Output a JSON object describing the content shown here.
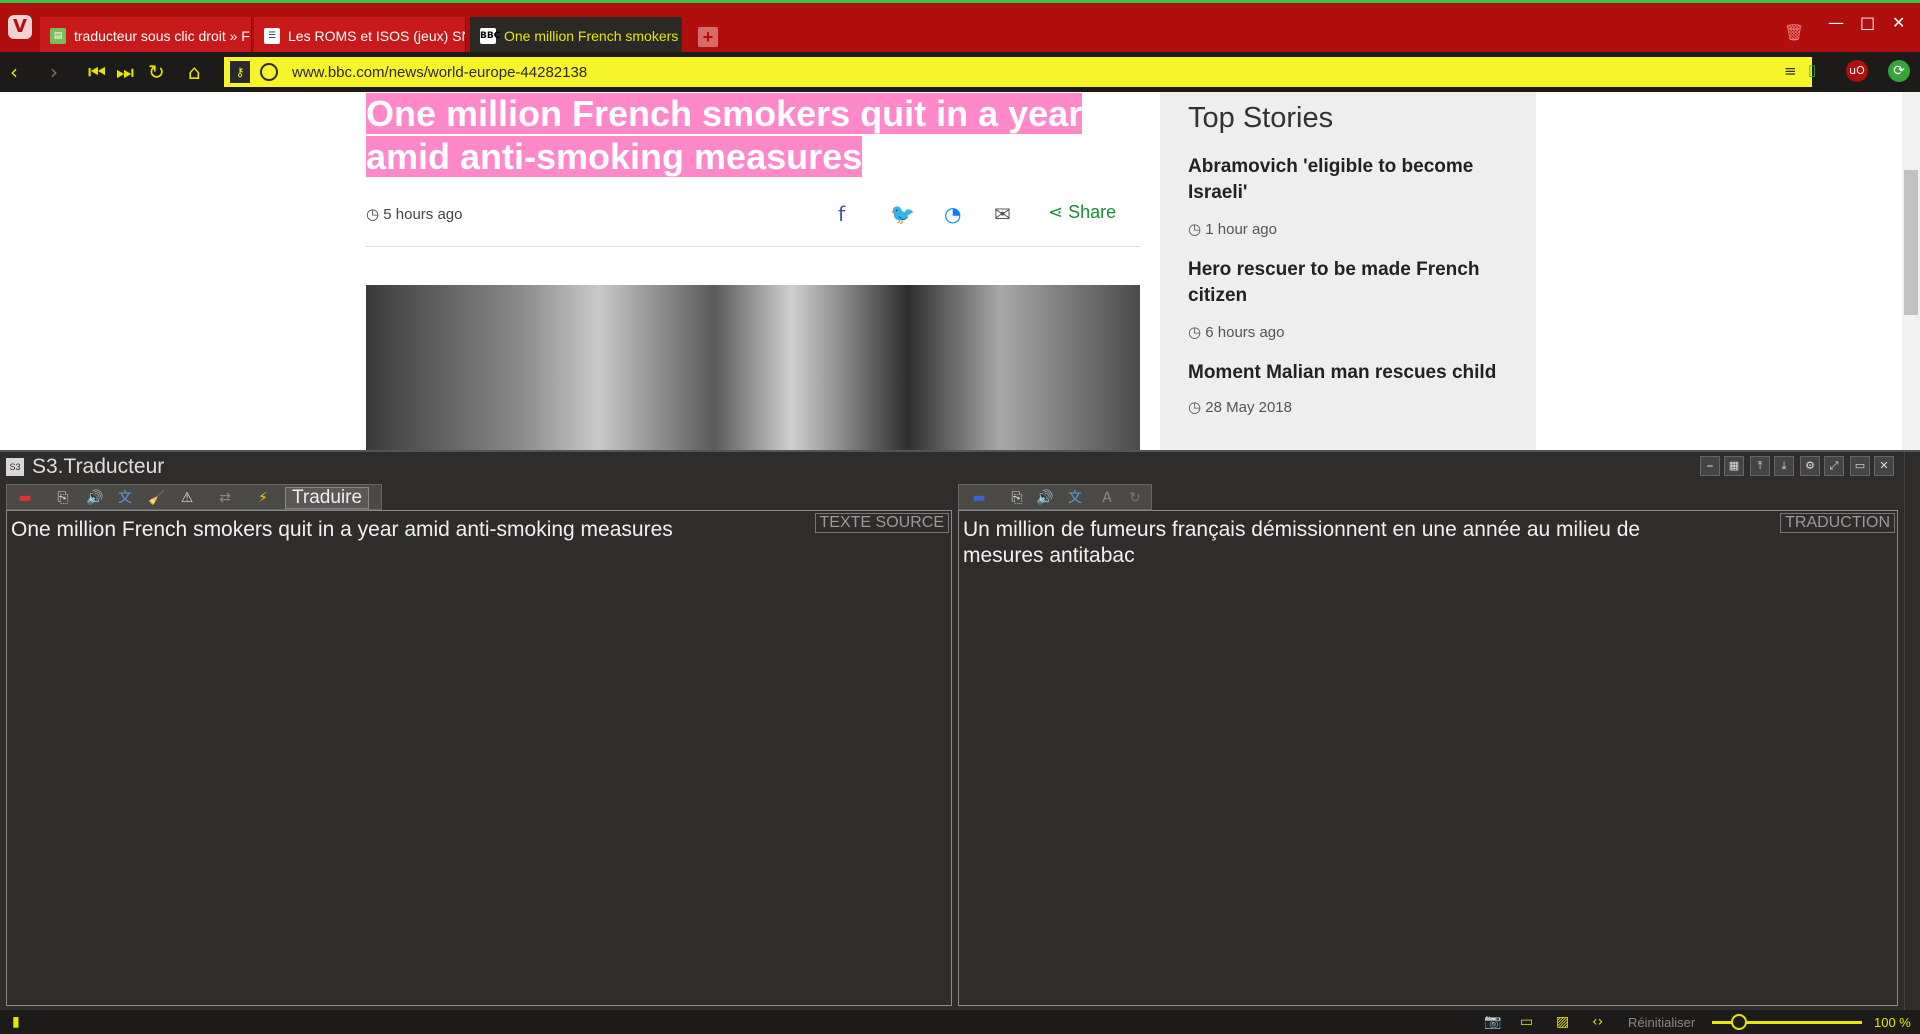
{
  "tabs": [
    {
      "label": "traducteur sous clic droit » F",
      "favicon": "green-doc-icon",
      "active": false
    },
    {
      "label": "Les ROMS et ISOS (jeux) SN",
      "favicon": "forum-icon",
      "active": false
    },
    {
      "label": "One million French smokers",
      "favicon": "bbc-icon",
      "active": true
    }
  ],
  "address_bar": {
    "url": "www.bbc.com/news/world-europe-44282138"
  },
  "article": {
    "headline": "One million French smokers quit in a year amid anti-smoking measures",
    "timestamp": "5 hours ago",
    "share_label": "Share"
  },
  "top_stories": {
    "title": "Top Stories",
    "items": [
      {
        "headline": "Abramovich 'eligible to become Israeli'",
        "time": "1 hour ago"
      },
      {
        "headline": "Hero rescuer to be made French citizen",
        "time": "6 hours ago"
      },
      {
        "headline": "Moment Malian man rescues child",
        "time": "28 May 2018"
      }
    ]
  },
  "translator": {
    "title": "S3.Traducteur",
    "translate_button": "Traduire",
    "source_label": "TEXTE SOURCE",
    "target_label": "TRADUCTION",
    "source_text": "One million French smokers quit in a year amid anti-smoking measures",
    "translated_text": "Un million de fumeurs français démissionnent en une année au milieu de mesures antitabac"
  },
  "status_bar": {
    "reset_label": "Réinitialiser",
    "zoom": "100 %"
  },
  "colors": {
    "tab_bar": "#b10e0e",
    "accent": "#e6e600",
    "highlight": "#ff88c8",
    "url_bg": "#f5f52a"
  }
}
